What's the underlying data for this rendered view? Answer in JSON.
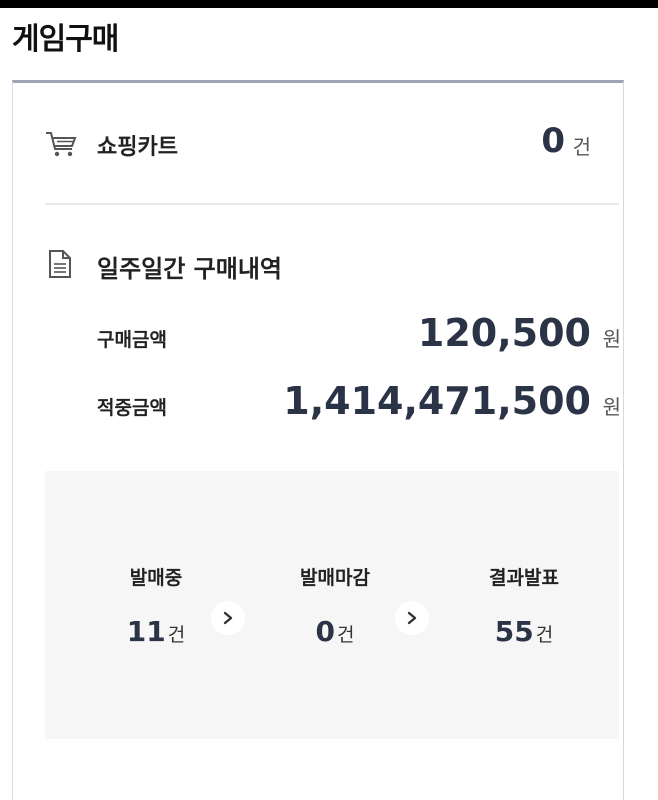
{
  "page": {
    "title": "게임구매"
  },
  "cart": {
    "label": "쇼핑카트",
    "count": "0",
    "unit": "건",
    "icon": "shopping-cart-icon"
  },
  "history": {
    "title": "일주일간 구매내역",
    "icon": "document-icon",
    "purchase": {
      "label": "구매금액",
      "value": "120,500",
      "unit": "원"
    },
    "prize": {
      "label": "적중금액",
      "value": "1,414,471,500",
      "unit": "원"
    }
  },
  "status": {
    "steps": [
      {
        "label": "발매중",
        "count": "11",
        "unit": "건"
      },
      {
        "label": "발매마감",
        "count": "0",
        "unit": "건"
      },
      {
        "label": "결과발표",
        "count": "55",
        "unit": "건"
      }
    ],
    "arrow_icon": "chevron-right-icon"
  },
  "colors": {
    "accent_border": "#9ca6b6",
    "value_text": "#2b3347",
    "panel_bg": "#f6f6f6"
  }
}
